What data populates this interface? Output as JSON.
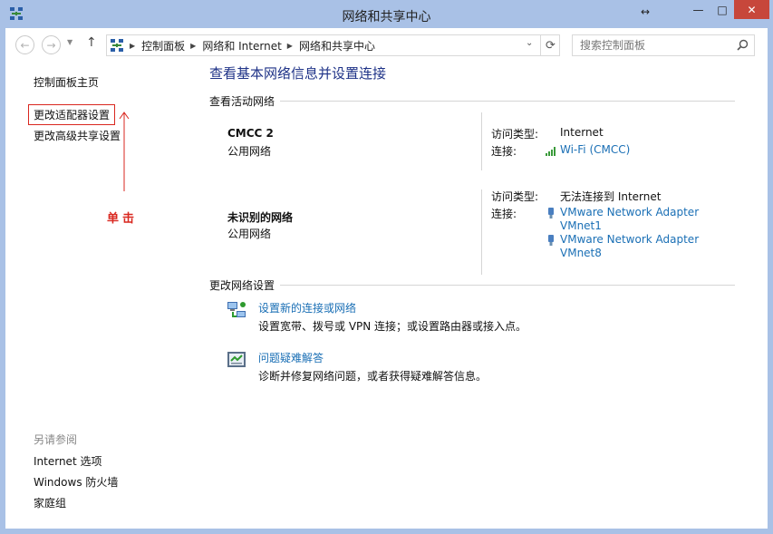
{
  "window": {
    "title": "网络和共享中心",
    "resize_glyph": "↔",
    "min_glyph": "—",
    "max_glyph": "□",
    "close_glyph": "✕"
  },
  "nav": {
    "back_glyph": "←",
    "forward_glyph": "→",
    "recent_glyph": "▼",
    "up_glyph": "↑"
  },
  "address": {
    "crumbs": [
      "控制面板",
      "网络和 Internet",
      "网络和共享中心"
    ],
    "separator": "▶",
    "dropdown_glyph": "⌄",
    "refresh_glyph": "⟳"
  },
  "search": {
    "placeholder": "搜索控制面板"
  },
  "sidebar": {
    "home": "控制面板主页",
    "change_adapter": "更改适配器设置",
    "advanced_sharing": "更改高级共享设置",
    "see_also": "另请参阅",
    "see_also_items": [
      "Internet 选项",
      "Windows 防火墙",
      "家庭组"
    ]
  },
  "annotation": {
    "text": "单击",
    "color": "#d9271f"
  },
  "main": {
    "title": "查看基本网络信息并设置连接",
    "active_networks_heading": "查看活动网络",
    "networks": [
      {
        "name": "CMCC  2",
        "category": "公用网络",
        "access_type_label": "访问类型:",
        "access_type": "Internet",
        "connections_label": "连接:",
        "connections": [
          "Wi-Fi (CMCC)"
        ]
      },
      {
        "name": "未识别的网络",
        "category": "公用网络",
        "access_type_label": "访问类型:",
        "access_type": "无法连接到 Internet",
        "connections_label": "连接:",
        "connections": [
          "VMware Network Adapter VMnet1",
          "VMware Network Adapter VMnet8"
        ]
      }
    ],
    "change_settings_heading": "更改网络设置",
    "tasks": [
      {
        "link": "设置新的连接或网络",
        "desc": "设置宽带、拨号或 VPN 连接；或设置路由器或接入点。",
        "icon": "new-connection-icon"
      },
      {
        "link": "问题疑难解答",
        "desc": "诊断并修复网络问题，或者获得疑难解答信息。",
        "icon": "troubleshoot-icon"
      }
    ]
  },
  "colors": {
    "title_bar": "#a9c1e6",
    "close_button": "#c7473b",
    "link": "#1a6fb5",
    "heading": "#1e3287"
  }
}
